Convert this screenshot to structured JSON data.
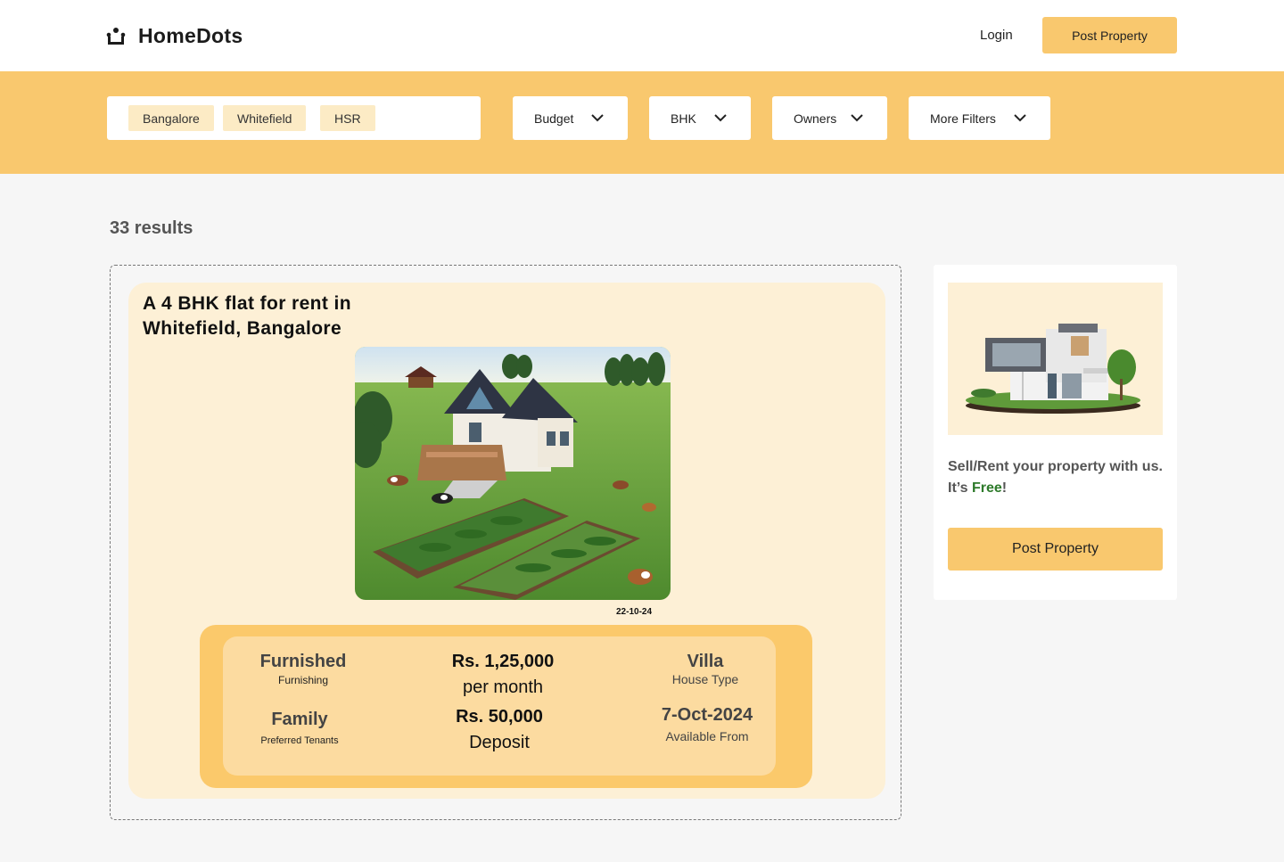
{
  "header": {
    "logo_text": "HomeDots",
    "login_label": "Login",
    "post_property_label": "Post Property"
  },
  "filters": {
    "location_chips": [
      "Bangalore",
      "Whitefield",
      "HSR"
    ],
    "dropdowns": [
      "Budget",
      "BHK",
      "Owners",
      "More Filters"
    ]
  },
  "results": {
    "count_text": "33 results"
  },
  "listing": {
    "title_line1": "A 4 BHK flat for rent in",
    "title_line2": "Whitefield, Bangalore",
    "posted_date": "22-10-24",
    "furnishing_value": "Furnished",
    "furnishing_label": "Furnishing",
    "tenants_value": "Family",
    "tenants_label": "Preferred Tenants",
    "rent_value": "Rs. 1,25,000",
    "rent_label": "per month",
    "deposit_value": "Rs. 50,000",
    "deposit_label": "Deposit",
    "house_type_value": "Villa",
    "house_type_label": "House Type",
    "available_value": "7-Oct-2024",
    "available_label": "Available From"
  },
  "sidebar": {
    "promo_text_before": "Sell/Rent your property with us. It’s ",
    "promo_free": "Free",
    "promo_after": "!",
    "button_label": "Post Property"
  },
  "colors": {
    "accent": "#f9c86e",
    "card_bg": "#fdf0d6",
    "free_green": "#2d7a2a"
  }
}
